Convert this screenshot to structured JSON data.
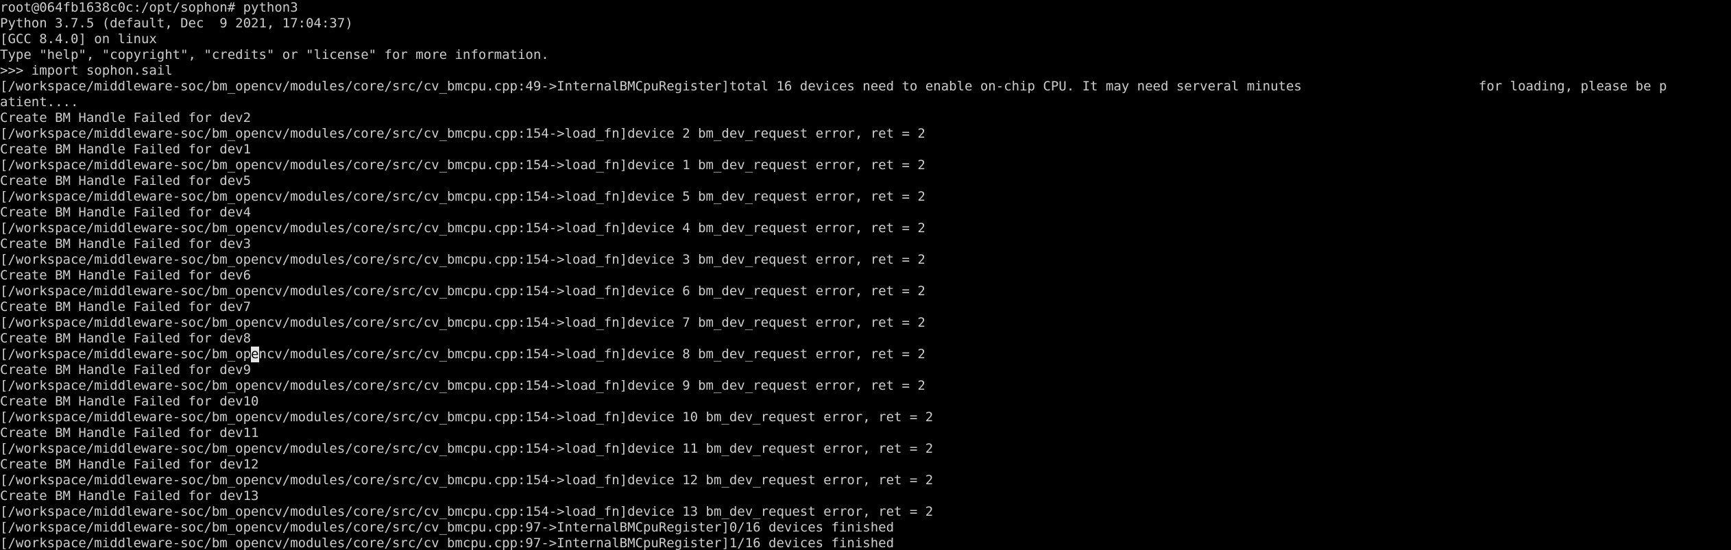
{
  "terminal": {
    "background": "#000000",
    "foreground": "#cccccc",
    "cursor_color": "#e6e6e6",
    "lines": [
      "root@064fb1638c0c:/opt/sophon# python3",
      "Python 3.7.5 (default, Dec  9 2021, 17:04:37)",
      "[GCC 8.4.0] on linux",
      "Type \"help\", \"copyright\", \"credits\" or \"license\" for more information.",
      ">>> import sophon.sail",
      "[/workspace/middleware-soc/bm_opencv/modules/core/src/cv_bmcpu.cpp:49->InternalBMCpuRegister]total 16 devices need to enable on-chip CPU. It may need serveral minutes",
      "atient....",
      "Create BM Handle Failed for dev2",
      "[/workspace/middleware-soc/bm_opencv/modules/core/src/cv_bmcpu.cpp:154->load_fn]device 2 bm_dev_request error, ret = 2",
      "Create BM Handle Failed for dev1",
      "[/workspace/middleware-soc/bm_opencv/modules/core/src/cv_bmcpu.cpp:154->load_fn]device 1 bm_dev_request error, ret = 2",
      "Create BM Handle Failed for dev5",
      "[/workspace/middleware-soc/bm_opencv/modules/core/src/cv_bmcpu.cpp:154->load_fn]device 5 bm_dev_request error, ret = 2",
      "Create BM Handle Failed for dev4",
      "[/workspace/middleware-soc/bm_opencv/modules/core/src/cv_bmcpu.cpp:154->load_fn]device 4 bm_dev_request error, ret = 2",
      "Create BM Handle Failed for dev3",
      "[/workspace/middleware-soc/bm_opencv/modules/core/src/cv_bmcpu.cpp:154->load_fn]device 3 bm_dev_request error, ret = 2",
      "Create BM Handle Failed for dev6",
      "[/workspace/middleware-soc/bm_opencv/modules/core/src/cv_bmcpu.cpp:154->load_fn]device 6 bm_dev_request error, ret = 2",
      "Create BM Handle Failed for dev7",
      "[/workspace/middleware-soc/bm_opencv/modules/core/src/cv_bmcpu.cpp:154->load_fn]device 7 bm_dev_request error, ret = 2",
      "Create BM Handle Failed for dev8",
      "",
      "Create BM Handle Failed for dev9",
      "[/workspace/middleware-soc/bm_opencv/modules/core/src/cv_bmcpu.cpp:154->load_fn]device 9 bm_dev_request error, ret = 2",
      "Create BM Handle Failed for dev10",
      "[/workspace/middleware-soc/bm_opencv/modules/core/src/cv_bmcpu.cpp:154->load_fn]device 10 bm_dev_request error, ret = 2",
      "Create BM Handle Failed for dev11",
      "[/workspace/middleware-soc/bm_opencv/modules/core/src/cv_bmcpu.cpp:154->load_fn]device 11 bm_dev_request error, ret = 2",
      "Create BM Handle Failed for dev12",
      "[/workspace/middleware-soc/bm_opencv/modules/core/src/cv_bmcpu.cpp:154->load_fn]device 12 bm_dev_request error, ret = 2",
      "Create BM Handle Failed for dev13",
      "[/workspace/middleware-soc/bm_opencv/modules/core/src/cv_bmcpu.cpp:154->load_fn]device 13 bm_dev_request error, ret = 2",
      "[/workspace/middleware-soc/bm_opencv/modules/core/src/cv_bmcpu.cpp:97->InternalBMCpuRegister]0/16 devices finished",
      "[/workspace/middleware-soc/bm_opencv/modules/core/src/cv_bmcpu.cpp:97->InternalBMCpuRegister]1/16 devices finished"
    ],
    "wrapped_tail": "for loading, please be p",
    "cursor_line": {
      "before": "[/workspace/middleware-soc/bm_op",
      "cursor_char": "e",
      "after": "ncv/modules/core/src/cv_bmcpu.cpp:154->load_fn]device 8 bm_dev_request error, ret = 2"
    }
  }
}
